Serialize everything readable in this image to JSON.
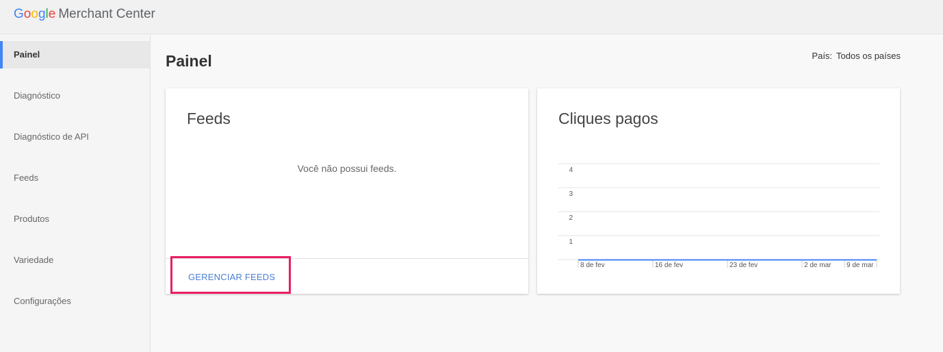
{
  "header": {
    "logo_google": [
      "G",
      "o",
      "o",
      "g",
      "l",
      "e"
    ],
    "logo_product": "Merchant Center"
  },
  "sidebar": {
    "items": [
      {
        "label": "Painel",
        "active": true
      },
      {
        "label": "Diagnóstico"
      },
      {
        "label": "Diagnóstico de API"
      },
      {
        "label": "Feeds"
      },
      {
        "label": "Produtos"
      },
      {
        "label": "Variedade"
      },
      {
        "label": "Configurações"
      }
    ]
  },
  "main": {
    "title": "Painel",
    "country_label": "País:",
    "country_value": "Todos os países"
  },
  "feeds_card": {
    "title": "Feeds",
    "empty_message": "Você não possui feeds.",
    "manage_button": "GERENCIAR FEEDS"
  },
  "clicks_card": {
    "title": "Cliques pagos"
  },
  "colors": {
    "accent": "#4285f4",
    "highlight": "#e91e63",
    "link": "#4a7fd6"
  },
  "chart_data": {
    "type": "line",
    "title": "Cliques pagos",
    "x": [
      "8 de fev",
      "16 de fev",
      "23 de fev",
      "2 de mar",
      "9 de mar"
    ],
    "yticks": [
      1,
      2,
      3,
      4
    ],
    "ylim": [
      0,
      4
    ],
    "series": [
      {
        "values": [
          0,
          0,
          0,
          0,
          0
        ]
      }
    ],
    "grid": true
  }
}
